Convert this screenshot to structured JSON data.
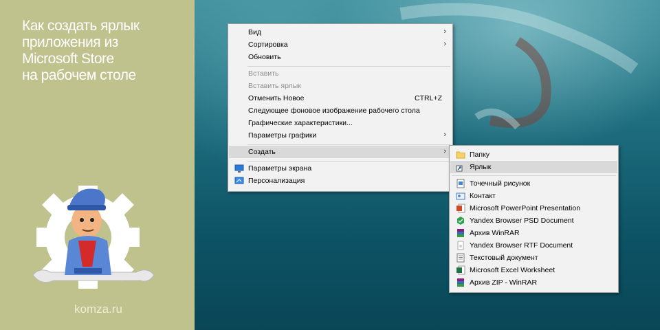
{
  "article": {
    "title": "Как создать ярлык\nприложения из\nMicrosoft Store\nна рабочем столе",
    "site": "komza.ru"
  },
  "context_menu": {
    "items": [
      {
        "label": "Вид",
        "submenu": true
      },
      {
        "label": "Сортировка",
        "submenu": true
      },
      {
        "label": "Обновить"
      },
      {
        "label": "Вставить",
        "disabled": true
      },
      {
        "label": "Вставить ярлык",
        "disabled": true
      },
      {
        "label": "Отменить Новое",
        "shortcut": "CTRL+Z"
      },
      {
        "label": "Следующее фоновое изображение рабочего стола"
      },
      {
        "label": "Графические характеристики..."
      },
      {
        "label": "Параметры графики",
        "submenu": true
      },
      {
        "label": "Создать",
        "submenu": true,
        "highlighted": true
      },
      {
        "label": "Параметры экрана",
        "icon": "display-icon"
      },
      {
        "label": "Персонализация",
        "icon": "personalize-icon"
      }
    ]
  },
  "create_submenu": {
    "items": [
      {
        "label": "Папку",
        "icon": "folder-icon"
      },
      {
        "label": "Ярлык",
        "icon": "shortcut-icon",
        "highlighted": true
      },
      {
        "label": "Точечный рисунок",
        "icon": "bitmap-icon"
      },
      {
        "label": "Контакт",
        "icon": "contact-icon"
      },
      {
        "label": "Microsoft PowerPoint Presentation",
        "icon": "powerpoint-icon"
      },
      {
        "label": "Yandex Browser PSD Document",
        "icon": "yandex-psd-icon"
      },
      {
        "label": "Архив WinRAR",
        "icon": "winrar-icon"
      },
      {
        "label": "Yandex Browser RTF Document",
        "icon": "rtf-icon"
      },
      {
        "label": "Текстовый документ",
        "icon": "text-doc-icon"
      },
      {
        "label": "Microsoft Excel Worksheet",
        "icon": "excel-icon"
      },
      {
        "label": "Архив ZIP - WinRAR",
        "icon": "zip-icon"
      }
    ]
  },
  "annotation": {
    "arrow_color": "#e02020"
  },
  "colors": {
    "panel_bg": "#bfc28d",
    "menu_bg": "#f2f2f2",
    "highlight": "#d9d9d9"
  }
}
